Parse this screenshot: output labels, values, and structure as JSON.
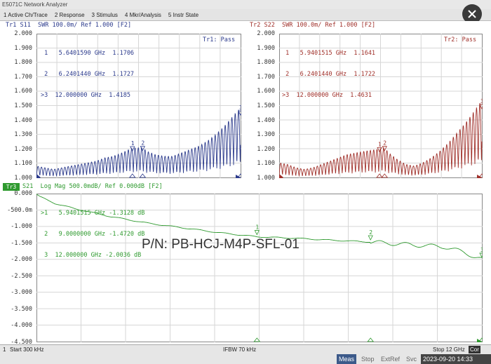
{
  "window_title": "E5071C Network Analyzer",
  "menu": [
    "1 Active Ch/Trace",
    "2 Response",
    "3 Stimulus",
    "4 Mkr/Analysis",
    "5 Instr State"
  ],
  "close_icon": "close-icon",
  "tr1": {
    "header": "Tr1 S11  SWR 100.0m/ Ref 1.000 [F2]",
    "color": "#2b3a8c",
    "pass": "Tr1: Pass",
    "markers": [
      " 1   5.6401590 GHz  1.1706",
      " 2   6.2401440 GHz  1.1727",
      ">3  12.000000 GHz  1.4185"
    ],
    "yticks": [
      "2.000",
      "1.900",
      "1.800",
      "1.700",
      "1.600",
      "1.500",
      "1.400",
      "1.300",
      "1.200",
      "1.100",
      "1.000"
    ]
  },
  "tr2": {
    "header": "Tr2 S22  SWR 100.0m/ Ref 1.000 [F2]",
    "color": "#a0302a",
    "pass": "Tr2: Pass",
    "markers": [
      " 1   5.9401515 GHz  1.1641",
      " 2   6.2401440 GHz  1.1722",
      ">3  12.000000 GHz  1.4631"
    ],
    "yticks": [
      "2.000",
      "1.900",
      "1.800",
      "1.700",
      "1.600",
      "1.500",
      "1.400",
      "1.300",
      "1.200",
      "1.100",
      "1.000"
    ]
  },
  "tr3": {
    "header": "S21  Log Mag 500.0mdB/ Ref 0.000dB [F2]",
    "badge": "Tr3",
    "color": "#2f9a2f",
    "markers": [
      ">1   5.9401515 GHz -1.3128 dB",
      " 2   9.0000000 GHz -1.4720 dB",
      " 3  12.000000 GHz -2.0036 dB"
    ],
    "yticks": [
      "0.000",
      "-500.0m",
      "-1.000",
      "-1.500",
      "-2.000",
      "-2.500",
      "-3.000",
      "-3.500",
      "-4.000",
      "-4.500"
    ]
  },
  "part_number": "P/N: PB-HCJ-M4P-SFL-01",
  "status": {
    "channel": "1",
    "start": "Start 300 kHz",
    "ifbw": "IFBW 70 kHz",
    "stop": "Stop 12 GHz",
    "cor": "Cor"
  },
  "bottom": {
    "meas": "Meas",
    "stop": "Stop",
    "extref": "ExtRef",
    "svc": "Svc",
    "datetime": "2023-09-20 14:33"
  },
  "chart_data": [
    {
      "type": "line",
      "title": "Tr1 S11 SWR 100.0m/ Ref 1.000 [F2]",
      "xlim": [
        0.0003,
        12
      ],
      "ylim": [
        1.0,
        2.0
      ],
      "grid": true,
      "series": [
        {
          "name": "S11",
          "x": [
            0.0003,
            0.5,
            1,
            1.5,
            2,
            2.5,
            3,
            3.5,
            4,
            4.5,
            5,
            5.64,
            6.24,
            6.5,
            7,
            7.5,
            8,
            8.5,
            9,
            9.5,
            10,
            10.5,
            11,
            11.5,
            12
          ],
          "y": [
            1.06,
            1.05,
            1.04,
            1.05,
            1.06,
            1.07,
            1.08,
            1.09,
            1.11,
            1.12,
            1.14,
            1.1706,
            1.1727,
            1.15,
            1.13,
            1.12,
            1.12,
            1.14,
            1.16,
            1.18,
            1.21,
            1.25,
            1.3,
            1.36,
            1.4185
          ]
        }
      ],
      "markers": [
        {
          "id": "1",
          "x": 5.640159,
          "y": 1.1706
        },
        {
          "id": "2",
          "x": 6.240144,
          "y": 1.1727
        },
        {
          "id": "3",
          "x": 12.0,
          "y": 1.4185
        }
      ]
    },
    {
      "type": "line",
      "title": "Tr2 S22 SWR 100.0m/ Ref 1.000 [F2]",
      "xlim": [
        0.0003,
        12
      ],
      "ylim": [
        1.0,
        2.0
      ],
      "grid": true,
      "series": [
        {
          "name": "S22",
          "x": [
            0.0003,
            0.5,
            1,
            1.5,
            2,
            2.5,
            3,
            3.5,
            4,
            4.5,
            5,
            5.94,
            6.24,
            6.5,
            7,
            7.5,
            8,
            8.5,
            9,
            9.5,
            10,
            10.5,
            11,
            11.5,
            12
          ],
          "y": [
            1.08,
            1.07,
            1.05,
            1.04,
            1.05,
            1.07,
            1.09,
            1.11,
            1.13,
            1.14,
            1.15,
            1.1641,
            1.1722,
            1.14,
            1.1,
            1.07,
            1.06,
            1.08,
            1.11,
            1.15,
            1.2,
            1.26,
            1.32,
            1.39,
            1.4631
          ]
        }
      ],
      "markers": [
        {
          "id": "1",
          "x": 5.9401515,
          "y": 1.1641
        },
        {
          "id": "2",
          "x": 6.240144,
          "y": 1.1722
        },
        {
          "id": "3",
          "x": 12.0,
          "y": 1.4631
        }
      ]
    },
    {
      "type": "line",
      "title": "S21 Log Mag 500.0mdB/ Ref 0.000dB [F2]",
      "xlim": [
        0.0003,
        12
      ],
      "ylim": [
        -4.5,
        0.0
      ],
      "grid": true,
      "series": [
        {
          "name": "S21",
          "x": [
            0.0003,
            0.1,
            0.5,
            1,
            2,
            3,
            4,
            5,
            5.94,
            7,
            8,
            9,
            10,
            11,
            11.5,
            12
          ],
          "y": [
            -0.02,
            -0.1,
            -0.3,
            -0.45,
            -0.7,
            -0.9,
            -1.05,
            -1.2,
            -1.3128,
            -1.36,
            -1.42,
            -1.472,
            -1.55,
            -1.62,
            -1.78,
            -2.0036
          ]
        }
      ],
      "markers": [
        {
          "id": "1",
          "x": 5.9401515,
          "y": -1.3128
        },
        {
          "id": "2",
          "x": 9.0,
          "y": -1.472
        },
        {
          "id": "3",
          "x": 12.0,
          "y": -2.0036
        }
      ]
    }
  ]
}
